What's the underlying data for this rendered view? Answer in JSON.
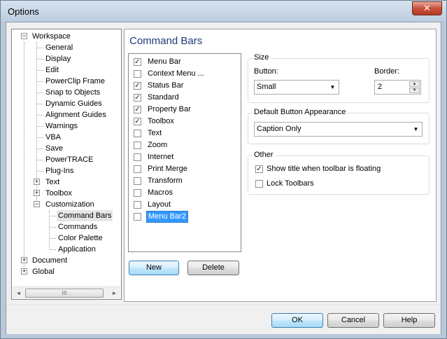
{
  "window": {
    "title": "Options",
    "close_glyph": "✕"
  },
  "tree": {
    "nodes": [
      {
        "label": "Workspace",
        "expander": "−"
      },
      {
        "label": "General"
      },
      {
        "label": "Display"
      },
      {
        "label": "Edit"
      },
      {
        "label": "PowerClip Frame"
      },
      {
        "label": "Snap to Objects"
      },
      {
        "label": "Dynamic Guides"
      },
      {
        "label": "Alignment Guides"
      },
      {
        "label": "Warnings"
      },
      {
        "label": "VBA"
      },
      {
        "label": "Save"
      },
      {
        "label": "PowerTRACE"
      },
      {
        "label": "Plug-Ins"
      },
      {
        "label": "Text",
        "expander": "+"
      },
      {
        "label": "Toolbox",
        "expander": "+"
      },
      {
        "label": "Customization",
        "expander": "−"
      },
      {
        "label": "Command Bars"
      },
      {
        "label": "Commands"
      },
      {
        "label": "Color Palette"
      },
      {
        "label": "Application"
      },
      {
        "label": "Document",
        "expander": "+"
      },
      {
        "label": "Global",
        "expander": "+"
      }
    ],
    "scroll_left": "◄",
    "scroll_right": "►",
    "thumb_grip": "III"
  },
  "panel": {
    "title": "Command Bars"
  },
  "command_bars": {
    "check_glyph": "✓",
    "items": [
      {
        "label": "Menu Bar",
        "checked": true
      },
      {
        "label": "Context Menu ...",
        "checked": false
      },
      {
        "label": "Status Bar",
        "checked": true
      },
      {
        "label": "Standard",
        "checked": true
      },
      {
        "label": "Property Bar",
        "checked": true
      },
      {
        "label": "Toolbox",
        "checked": true
      },
      {
        "label": "Text",
        "checked": false
      },
      {
        "label": "Zoom",
        "checked": false
      },
      {
        "label": "Internet",
        "checked": false
      },
      {
        "label": "Print Merge",
        "checked": false
      },
      {
        "label": "Transform",
        "checked": false
      },
      {
        "label": "Macros",
        "checked": false
      },
      {
        "label": "Layout",
        "checked": false
      },
      {
        "label": "Menu Bar2",
        "checked": false
      }
    ],
    "new_label": "New",
    "delete_label": "Delete"
  },
  "size_group": {
    "caption": "Size",
    "button_label": "Button:",
    "button_value": "Small",
    "border_label": "Border:",
    "border_value": "2",
    "combo_arrow": "▼",
    "spin_up": "▲",
    "spin_down": "▼"
  },
  "appearance_group": {
    "caption": "Default Button Appearance",
    "value": "Caption Only"
  },
  "other_group": {
    "caption": "Other",
    "show_title_label": "Show title when toolbar is floating",
    "show_title_checked": true,
    "lock_label": "Lock Toolbars",
    "lock_checked": false
  },
  "footer": {
    "ok_label": "OK",
    "cancel_label": "Cancel",
    "help_label": "Help"
  }
}
